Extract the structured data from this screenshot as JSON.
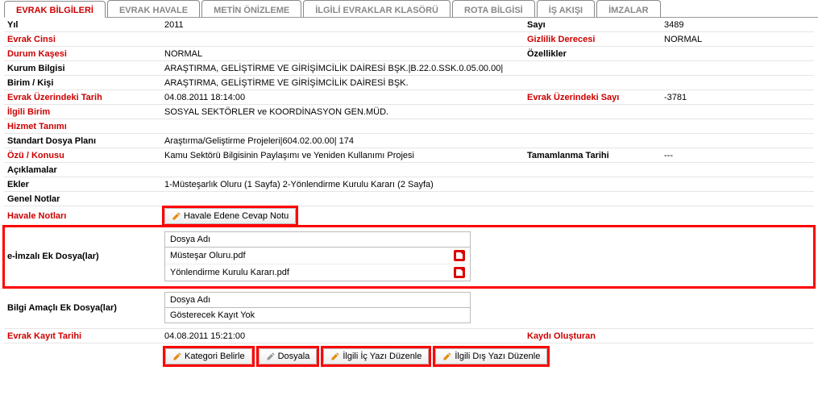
{
  "tabs": {
    "t0": "EVRAK BİLGİLERİ",
    "t1": "EVRAK HAVALE",
    "t2": "METİN ÖNİZLEME",
    "t3": "İLGİLİ EVRAKLAR KLASÖRÜ",
    "t4": "ROTA BİLGİSİ",
    "t5": "İŞ AKIŞI",
    "t6": "İMZALAR"
  },
  "labels": {
    "yil": "Yıl",
    "sayi": "Sayı",
    "evrak_cinsi": "Evrak Cinsi",
    "gizlilik": "Gizlilik Derecesi",
    "durum": "Durum Kaşesi",
    "ozellikler": "Özellikler",
    "kurum": "Kurum Bilgisi",
    "birim_kisi": "Birim / Kişi",
    "tarih": "Evrak Üzerindeki Tarih",
    "sayi2": "Evrak Üzerindeki Sayı",
    "ilgili_birim": "İlgili Birim",
    "hizmet": "Hizmet Tanımı",
    "dosya_plan": "Standart Dosya Planı",
    "ozu": "Özü / Konusu",
    "tamamlanma": "Tamamlanma Tarihi",
    "aciklama": "Açıklamalar",
    "ekler": "Ekler",
    "genel_not": "Genel Notlar",
    "havale_not": "Havale Notları",
    "eimza": "e-İmzalı Ek Dosya(lar)",
    "bilgi": "Bilgi Amaçlı Ek Dosya(lar)",
    "kayit_tarih": "Evrak Kayıt Tarihi",
    "kaydi_olusturan": "Kaydı Oluşturan",
    "dosya_adi": "Dosya Adı",
    "no_record": "Gösterecek Kayıt Yok"
  },
  "values": {
    "yil": "2011",
    "sayi": "3489",
    "gizlilik": "NORMAL",
    "durum": "NORMAL",
    "kurum": "ARAŞTIRMA, GELİŞTİRME VE GİRİŞİMCİLİK DAİRESİ BŞK.|B.22.0.SSK.0.05.00.00|",
    "birim_kisi": "ARAŞTIRMA, GELİŞTİRME VE GİRİŞİMCİLİK DAİRESİ BŞK.",
    "tarih": "04.08.2011 18:14:00",
    "sayi2": "-3781",
    "ilgili_birim": "SOSYAL SEKTÖRLER ve KOORDİNASYON GEN.MÜD.",
    "dosya_plan": "Araştırma/Geliştirme Projeleri|604.02.00.00| 174",
    "ozu": "Kamu Sektörü Bilgisinin Paylaşımı ve Yeniden Kullanımı Projesi",
    "tamamlanma": "---",
    "ekler": "1-Müsteşarlık Oluru (1 Sayfa) 2-Yönlendirme Kurulu Kararı (2 Sayfa)",
    "kayit_tarih": "04.08.2011 15:21:00"
  },
  "files": {
    "f0": "Müsteşar Oluru.pdf",
    "f1": "Yönlendirme Kurulu Kararı.pdf"
  },
  "buttons": {
    "havale_not": "Havale Edene Cevap Notu",
    "kategori": "Kategori Belirle",
    "dosyala": "Dosyala",
    "ic_yazi": "İlgili İç Yazı Düzenle",
    "dis_yazi": "İlgili Dış Yazı Düzenle"
  }
}
